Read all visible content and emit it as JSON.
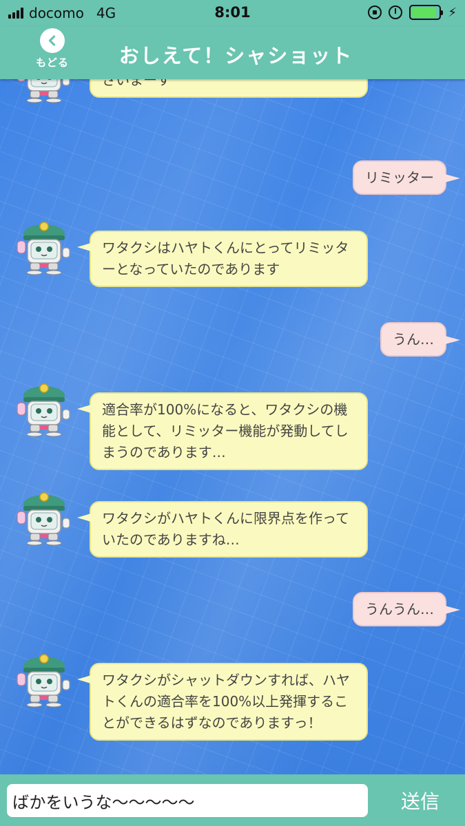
{
  "status_bar": {
    "carrier": "docomo",
    "network": "4G",
    "time": "8:01",
    "icons": [
      "signal-icon",
      "orientation-lock-icon",
      "alarm-icon",
      "battery-icon",
      "charging-bolt-icon"
    ],
    "battery_level": 0.9
  },
  "header": {
    "back_label": "もどる",
    "title": "おしえて！シャショット"
  },
  "messages": [
    {
      "sender": "bot",
      "text": "武器や必殺技が使えるようになるのでございまーす"
    },
    {
      "sender": "user",
      "text": "リミッター"
    },
    {
      "sender": "bot",
      "text": "ワタクシはハヤトくんにとってリミッターとなっていたのであります"
    },
    {
      "sender": "user",
      "text": "うん…"
    },
    {
      "sender": "bot",
      "text": "適合率が100%になると、ワタクシの機能として、リミッター機能が発動してしまうのであります…"
    },
    {
      "sender": "bot",
      "text": "ワタクシがハヤトくんに限界点を作っていたのでありますね…"
    },
    {
      "sender": "user",
      "text": "うんうん…"
    },
    {
      "sender": "bot",
      "text": "ワタクシがシャットダウンすれば、ハヤトくんの適合率を100%以上発揮することができるはずなのでありますっ！"
    }
  ],
  "input": {
    "value": "ばかをいうな〜〜〜〜〜",
    "send_label": "送信"
  },
  "colors": {
    "header_bg": "#69c4b0",
    "bot_bubble": "#fafac0",
    "user_bubble": "#fbe0e0",
    "chat_bg": "#3e83e6"
  }
}
